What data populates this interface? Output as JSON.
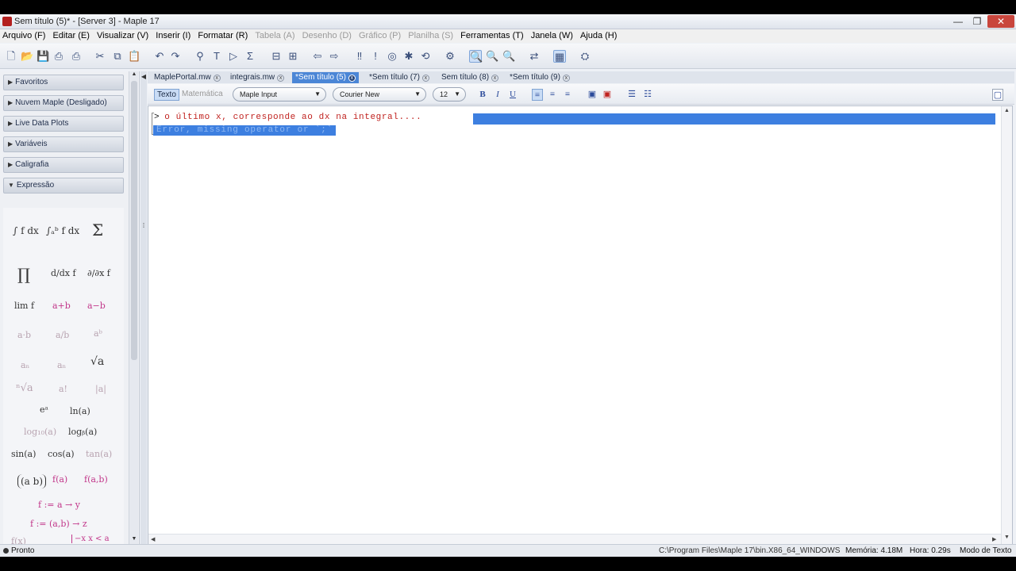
{
  "window": {
    "title": "Sem título (5)* - [Server 3] - Maple 17",
    "controls": {
      "minimize": "—",
      "maximize": "❐",
      "close": "✕"
    }
  },
  "menu": [
    {
      "label": "Arquivo (F)",
      "enabled": true
    },
    {
      "label": "Editar (E)",
      "enabled": true
    },
    {
      "label": "Visualizar (V)",
      "enabled": true
    },
    {
      "label": "Inserir (I)",
      "enabled": true
    },
    {
      "label": "Formatar (R)",
      "enabled": true
    },
    {
      "label": "Tabela (A)",
      "enabled": false
    },
    {
      "label": "Desenho (D)",
      "enabled": false
    },
    {
      "label": "Gráfico (P)",
      "enabled": false
    },
    {
      "label": "Planilha (S)",
      "enabled": false
    },
    {
      "label": "Ferramentas (T)",
      "enabled": true
    },
    {
      "label": "Janela (W)",
      "enabled": true
    },
    {
      "label": "Ajuda (H)",
      "enabled": true
    }
  ],
  "toolbar_icons": [
    {
      "name": "new-document-icon",
      "glyph": "🗋"
    },
    {
      "name": "open-folder-icon",
      "glyph": "📂"
    },
    {
      "name": "save-icon",
      "glyph": "💾"
    },
    {
      "name": "print-icon",
      "glyph": "⎙"
    },
    {
      "name": "print-preview-icon",
      "glyph": "⎙"
    },
    {
      "name": "cut-icon",
      "glyph": "✂"
    },
    {
      "name": "copy-icon",
      "glyph": "⧉"
    },
    {
      "name": "paste-icon",
      "glyph": "📋"
    },
    {
      "name": "undo-icon",
      "glyph": "↶"
    },
    {
      "name": "redo-icon",
      "glyph": "↷"
    },
    {
      "name": "find-icon",
      "glyph": "⚲"
    },
    {
      "name": "text-icon",
      "glyph": "T"
    },
    {
      "name": "prompt-icon",
      "glyph": "▷"
    },
    {
      "name": "sum-icon",
      "glyph": "Σ"
    },
    {
      "name": "group-icon",
      "glyph": "⊟"
    },
    {
      "name": "ungroup-icon",
      "glyph": "⊞"
    },
    {
      "name": "back-arrow-icon",
      "glyph": "⇦"
    },
    {
      "name": "forward-arrow-icon",
      "glyph": "⇨"
    },
    {
      "name": "execute-all-icon",
      "glyph": "‼"
    },
    {
      "name": "italic-execute-icon",
      "glyph": "!"
    },
    {
      "name": "stop-icon",
      "glyph": "◎"
    },
    {
      "name": "debug-icon",
      "glyph": "✱"
    },
    {
      "name": "restart-icon",
      "glyph": "⟲"
    },
    {
      "name": "settings-icon",
      "glyph": "⚙"
    },
    {
      "name": "zoom-100-icon",
      "glyph": "🔍"
    },
    {
      "name": "zoom-150-icon",
      "glyph": "🔍"
    },
    {
      "name": "zoom-200-icon",
      "glyph": "🔍"
    },
    {
      "name": "swap-icon",
      "glyph": "⇄"
    },
    {
      "name": "layout-icon",
      "glyph": "▦"
    },
    {
      "name": "help-icon",
      "glyph": "⛭"
    }
  ],
  "palettes": [
    {
      "label": "Favoritos"
    },
    {
      "label": "Nuvem Maple (Desligado)"
    },
    {
      "label": "Live Data Plots"
    },
    {
      "label": "Variáveis"
    },
    {
      "label": "Caligrafia"
    },
    {
      "label": "Expressão"
    }
  ],
  "expression_palette": [
    "∫ f dx",
    "∫ₐᵇ f dx",
    "Σ",
    "∏",
    "d/dx f",
    "∂/∂x f",
    "lim f",
    "a+b",
    "a−b",
    "a·b",
    "a/b",
    "aᵇ",
    "aₙ",
    "aₙ",
    "√a",
    "ⁿ√a",
    "a!",
    "|a|",
    "eᵃ",
    "ln(a)",
    "log₁₀(a)",
    "logᵦ(a)",
    "sin(a)",
    "cos(a)",
    "tan(a)",
    "(a b)",
    "f(a)",
    "f(a,b)",
    "f := a → y",
    "f := (a,b) → z",
    "f(x)",
    "−x  x < a"
  ],
  "tabs": [
    {
      "label": "MaplePortal.mw",
      "active": false
    },
    {
      "label": "integrais.mw",
      "active": false
    },
    {
      "label": "*Sem título (5)",
      "active": true
    },
    {
      "label": "*Sem título (7)",
      "active": false
    },
    {
      "label": "Sem título (8)",
      "active": false
    },
    {
      "label": "*Sem título (9)",
      "active": false
    }
  ],
  "format_bar": {
    "mode_text": "Texto",
    "mode_math": "Matemática",
    "style_combo": "Maple Input",
    "font_combo": "Courier New",
    "size_combo": "12",
    "bold": "B",
    "italic": "I",
    "underline": "U"
  },
  "document": {
    "prompt": ">",
    "input": "o último x, corresponde ao dx na integral....",
    "error": "Error, missing operator or `;`"
  },
  "status": {
    "ready": "Pronto",
    "path": "C:\\Program Files\\Maple 17\\bin.X86_64_WINDOWS",
    "memory": "Memória: 4.18M",
    "time": "Hora: 0.29s",
    "mode": "Modo de Texto"
  }
}
